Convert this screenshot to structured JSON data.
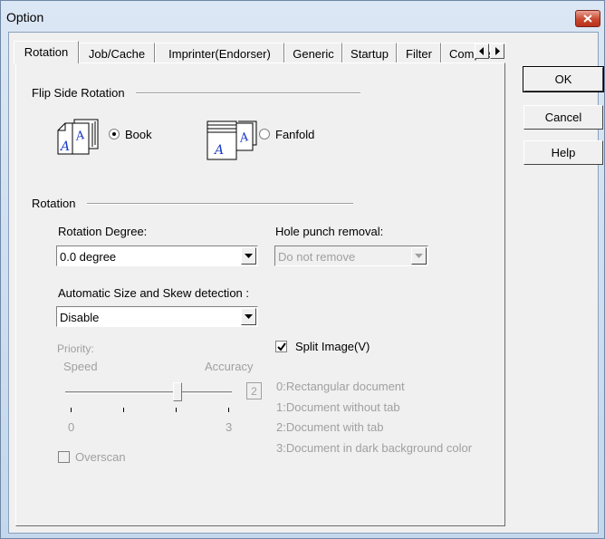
{
  "window": {
    "title": "Option"
  },
  "tabs": [
    {
      "label": "Rotation"
    },
    {
      "label": "Job/Cache"
    },
    {
      "label": "Imprinter(Endorser)"
    },
    {
      "label": "Generic"
    },
    {
      "label": "Startup"
    },
    {
      "label": "Filter"
    },
    {
      "label": "Compre"
    }
  ],
  "buttons": {
    "ok": "OK",
    "cancel": "Cancel",
    "help": "Help"
  },
  "flip_side": {
    "group_label": "Flip Side Rotation",
    "book_label": "Book",
    "fanfold_label": "Fanfold",
    "selected": "Book"
  },
  "rotation": {
    "group_label": "Rotation",
    "degree_label": "Rotation Degree:",
    "degree_value": "0.0 degree",
    "hole_label": "Hole punch removal:",
    "hole_value": "Do not remove",
    "auto_label": "Automatic Size and Skew detection :",
    "auto_value": "Disable",
    "priority_label": "Priority:",
    "speed_label": "Speed",
    "accuracy_label": "Accuracy",
    "slider_value": "2",
    "scale_min": "0",
    "scale_max": "3",
    "overscan_label": "Overscan",
    "split_label": "Split Image(V)",
    "split_checked": true,
    "doc_types": [
      "0:Rectangular document",
      "1:Document without tab",
      "2:Document with tab",
      "3:Document in dark background color"
    ]
  }
}
